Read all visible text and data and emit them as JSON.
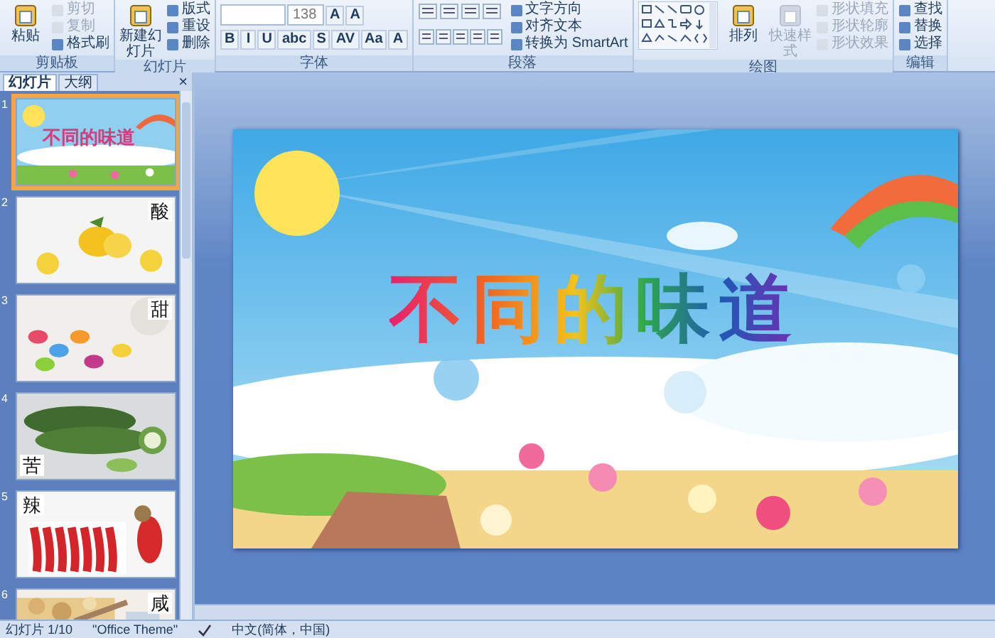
{
  "ribbon": {
    "groups": [
      {
        "kind": "basic",
        "label": "剪贴板",
        "large": [
          {
            "label": "粘贴",
            "disabled": false
          }
        ],
        "small": [
          {
            "label": "剪切",
            "disabled": true
          },
          {
            "label": "复制",
            "disabled": true
          },
          {
            "label": "格式刷",
            "disabled": false
          }
        ]
      },
      {
        "kind": "basic",
        "label": "幻灯片",
        "large": [
          {
            "label": "新建幻灯片",
            "disabled": false
          }
        ],
        "small": [
          {
            "label": "版式",
            "disabled": false
          },
          {
            "label": "重设",
            "disabled": false
          },
          {
            "label": "删除",
            "disabled": false
          }
        ]
      },
      {
        "kind": "font",
        "label": "字体",
        "size": "138",
        "size_buttons": [
          "A",
          "A"
        ],
        "format_buttons": [
          "B",
          "I",
          "U",
          "abc",
          "S",
          "AV",
          "Aa",
          "A"
        ]
      },
      {
        "kind": "paragraph",
        "label": "段落",
        "small": [
          {
            "label": "文字方向",
            "disabled": false
          },
          {
            "label": "对齐文本",
            "disabled": false
          },
          {
            "label": "转换为 SmartArt",
            "disabled": false
          }
        ]
      },
      {
        "kind": "drawing",
        "label": "绘图",
        "large": [
          {
            "label": "排列",
            "disabled": false
          },
          {
            "label": "快速样式",
            "disabled": true
          }
        ],
        "small": [
          {
            "label": "形状填充",
            "disabled": true
          },
          {
            "label": "形状轮廓",
            "disabled": true
          },
          {
            "label": "形状效果",
            "disabled": true
          }
        ]
      },
      {
        "kind": "basic",
        "label": "编辑",
        "small": [
          {
            "label": "查找",
            "disabled": false
          },
          {
            "label": "替换",
            "disabled": false
          },
          {
            "label": "选择",
            "disabled": false
          }
        ]
      }
    ]
  },
  "pane": {
    "tabs": [
      {
        "label": "幻灯片",
        "selected": true
      },
      {
        "label": "大纲",
        "selected": false
      }
    ],
    "close": "×",
    "thumbnails": [
      {
        "number": "1",
        "kind": "title",
        "label": "不同的味道",
        "selected": true
      },
      {
        "number": "2",
        "kind": "lemon",
        "label": "酸",
        "selected": false
      },
      {
        "number": "3",
        "kind": "candy",
        "label": "甜",
        "selected": false
      },
      {
        "number": "4",
        "kind": "melon",
        "label": "苦",
        "selected": false
      },
      {
        "number": "5",
        "kind": "chili",
        "label": "辣",
        "selected": false
      },
      {
        "number": "6",
        "kind": "salty",
        "label": "咸",
        "selected": false
      }
    ]
  },
  "slide": {
    "title": "不同的味道"
  },
  "status_bar": {
    "slide": "幻灯片 1/10",
    "theme": "\"Office Theme\"",
    "language": "中文(简体，中国)"
  }
}
